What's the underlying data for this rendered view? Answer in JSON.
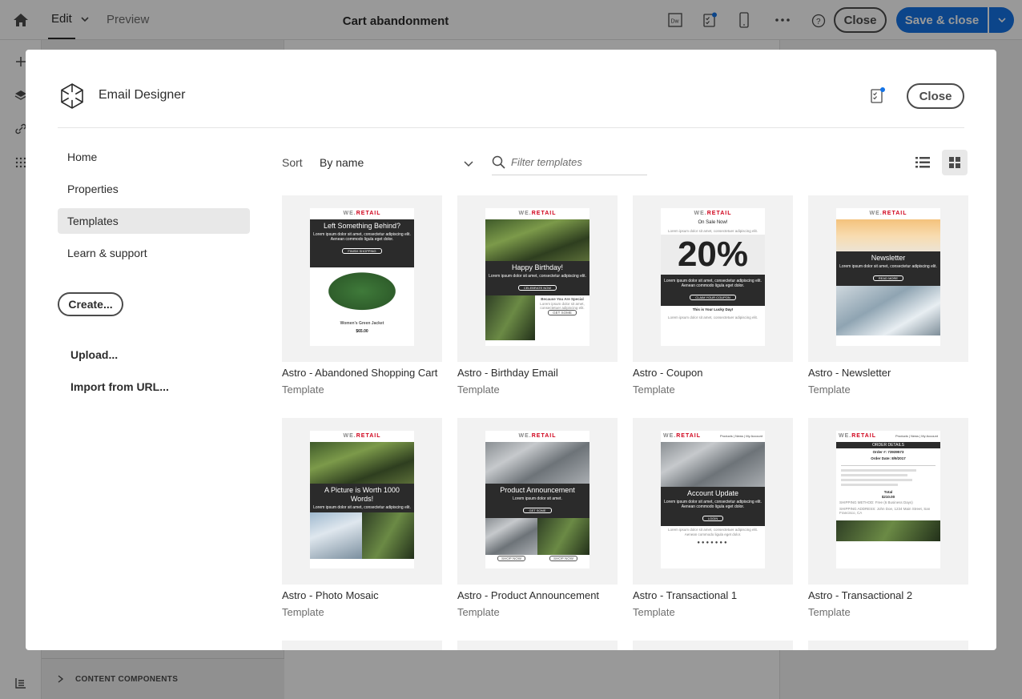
{
  "topbar": {
    "edit_label": "Edit",
    "preview_label": "Preview",
    "doc_title": "Cart abandonment",
    "dw_label": "Dw",
    "close_label": "Close",
    "save_label": "Save & close",
    "accent_color": "#1473e6"
  },
  "left_panel": {
    "content_components_label": "CONTENT COMPONENTS"
  },
  "modal": {
    "title": "Email Designer",
    "close_label": "Close",
    "nav": [
      "Home",
      "Properties",
      "Templates",
      "Learn & support"
    ],
    "active_nav": "Templates",
    "create_label": "Create...",
    "upload_label": "Upload...",
    "import_label": "Import from URL...",
    "sort_label": "Sort",
    "sort_value": "By name",
    "search_placeholder": "Filter templates",
    "view_mode": "grid"
  },
  "templates": [
    {
      "name": "Astro - Abandoned Shopping Cart",
      "type": "Template",
      "thumb": {
        "brand": "RETAIL",
        "headline": "Left Something Behind?",
        "body": "Lorem ipsum dolor sit amet, consectetur adipiscing elit. Aenean commodo ligula eget dolor.",
        "button": "FINISH SHOPPING",
        "caption": "Women's Green Jacket",
        "price": "$65.00",
        "account": "MY ACCOUNT"
      }
    },
    {
      "name": "Astro - Birthday Email",
      "type": "Template",
      "thumb": {
        "brand": "RETAIL",
        "headline": "Happy Birthday!",
        "body": "Lorem ipsum dolor sit amet, consectetur adipiscing elit.",
        "button": "CELEBRATE NOW",
        "side_title": "Because You Are Special",
        "side_button": "GET SOME"
      }
    },
    {
      "name": "Astro - Coupon",
      "type": "Template",
      "thumb": {
        "brand": "RETAIL",
        "headline": "On Sale Now!",
        "big": "20%",
        "body": "Lorem ipsum dolor sit amet, consectetur adipiscing elit. Aenean commodo ligula eget dolor.",
        "button": "CLAIM YOUR COUPON",
        "footer_title": "This is Your Lucky Day!"
      }
    },
    {
      "name": "Astro - Newsletter",
      "type": "Template",
      "thumb": {
        "brand": "RETAIL",
        "headline": "Newsletter",
        "body": "Lorem ipsum dolor sit amet, consectetur adipiscing elit.",
        "button": "READ MORE"
      }
    },
    {
      "name": "Astro - Photo Mosaic",
      "type": "Template",
      "thumb": {
        "brand": "RETAIL",
        "headline": "A Picture is Worth 1000 Words!",
        "body": "Lorem ipsum dolor sit amet, consectetur adipiscing elit."
      }
    },
    {
      "name": "Astro - Product Announcement",
      "type": "Template",
      "thumb": {
        "brand": "RETAIL",
        "headline": "Product Announcement",
        "body": "Lorem ipsum dolor sit amet.",
        "button": "GET SOME",
        "shop": "SHOP NOW"
      }
    },
    {
      "name": "Astro - Transactional 1",
      "type": "Template",
      "thumb": {
        "brand": "RETAIL",
        "headline": "Account Update",
        "body": "Lorem ipsum dolor sit amet, consectetur adipiscing elit. Aenean commodo ligula eget dolor.",
        "button": "LOGIN",
        "links": "Products | News | My Account"
      }
    },
    {
      "name": "Astro - Transactional 2",
      "type": "Template",
      "thumb": {
        "brand": "RETAIL",
        "headline": "ORDER DETAILS",
        "order": "Order #: 73939573",
        "date": "Order Date: 8/9/2017",
        "total_label": "Total",
        "total": "$210.00",
        "links": "Products | News | My Account"
      }
    }
  ]
}
